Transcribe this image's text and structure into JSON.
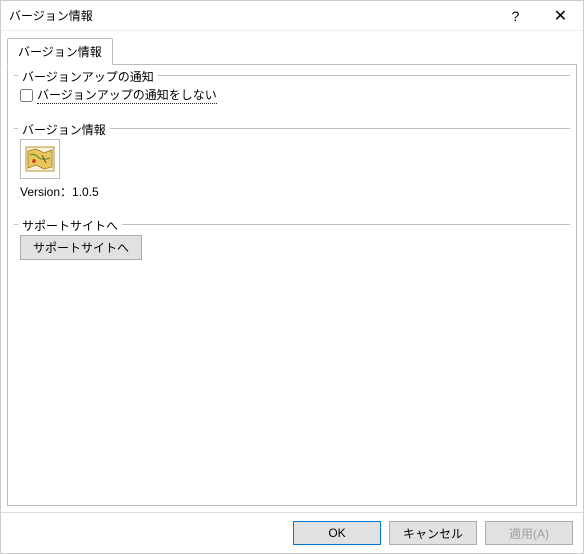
{
  "window": {
    "title": "バージョン情報"
  },
  "tabs": [
    {
      "label": "バージョン情報"
    }
  ],
  "groups": {
    "upgrade": {
      "title": "バージョンアップの通知",
      "checkbox_label": "バージョンアップの通知をしない"
    },
    "version": {
      "title": "バージョン情報",
      "version_text": "Version：1.0.5"
    },
    "support": {
      "title": "サポートサイトへ",
      "button_label": "サポートサイトへ"
    }
  },
  "footer": {
    "ok": "OK",
    "cancel": "キャンセル",
    "apply": "適用(A)"
  }
}
